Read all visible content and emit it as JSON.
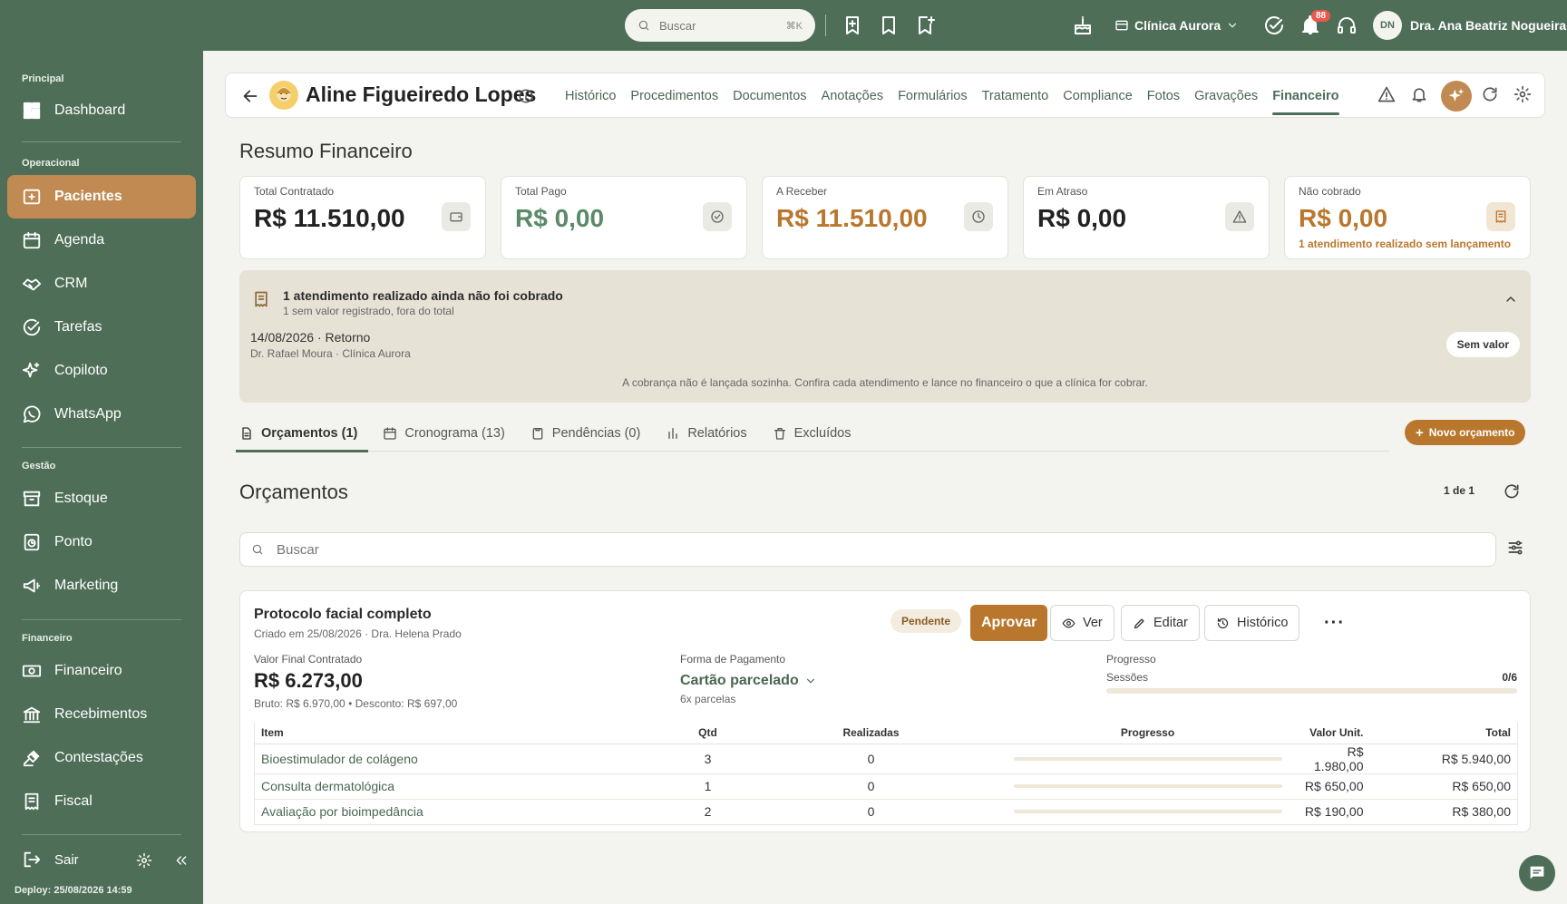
{
  "topbar": {
    "search_placeholder": "Buscar",
    "search_shortcut": "⌘K",
    "clinic": "Clínica Aurora",
    "notifications": "88",
    "user_initials": "DN",
    "user_name": "Dra. Ana Beatriz Nogueira"
  },
  "sidebar": {
    "sections": {
      "principal": "Principal",
      "operacional": "Operacional",
      "gestao": "Gestão",
      "financeiro": "Financeiro"
    },
    "items": {
      "dashboard": "Dashboard",
      "pacientes": "Pacientes",
      "agenda": "Agenda",
      "crm": "CRM",
      "tarefas": "Tarefas",
      "copiloto": "Copiloto",
      "whatsapp": "WhatsApp",
      "estoque": "Estoque",
      "ponto": "Ponto",
      "marketing": "Marketing",
      "financeiro": "Financeiro",
      "recebimentos": "Recebimentos",
      "contestacoes": "Contestações",
      "fiscal": "Fiscal"
    },
    "logout": "Sair",
    "deploy": "Deploy: 25/08/2026 14:59"
  },
  "patient": {
    "name": "Aline Figueiredo Lopes",
    "tabs": [
      "Histórico",
      "Procedimentos",
      "Documentos",
      "Anotações",
      "Formulários",
      "Tratamento",
      "Compliance",
      "Fotos",
      "Gravações",
      "Financeiro"
    ]
  },
  "summary": {
    "title": "Resumo Financeiro",
    "cards": [
      {
        "label": "Total Contratado",
        "value": "R$ 11.510,00",
        "color": "#222222"
      },
      {
        "label": "Total Pago",
        "value": "R$ 0,00",
        "color": "#5a8a68"
      },
      {
        "label": "A Receber",
        "value": "R$ 11.510,00",
        "color": "#b9772d"
      },
      {
        "label": "Em Atraso",
        "value": "R$ 0,00",
        "color": "#222222"
      },
      {
        "label": "Não cobrado",
        "value": "R$ 0,00",
        "color": "#b9772d",
        "note": "1 atendimento realizado sem lançamento"
      }
    ]
  },
  "alert": {
    "title": "1 atendimento realizado ainda não foi cobrado",
    "subtitle": "1 sem valor registrado, fora do total",
    "date_line": "14/08/2026 · Retorno",
    "doctor_line": "Dr. Rafael Moura · Clínica Aurora",
    "badge": "Sem valor",
    "footer": "A cobrança não é lançada sozinha. Confira cada atendimento e lance no financeiro o que a clínica for cobrar."
  },
  "subtabs": [
    "Orçamentos (1)",
    "Cronograma (13)",
    "Pendências (0)",
    "Relatórios",
    "Excluídos"
  ],
  "new_budget": "Novo orçamento",
  "budgets": {
    "title": "Orçamentos",
    "pagination": "1 de 1",
    "search_placeholder": "Buscar"
  },
  "budget": {
    "title": "Protocolo facial completo",
    "created": "Criado em 25/08/2026 · Dra. Helena Prado",
    "status": "Pendente",
    "approve": "Aprovar",
    "view": "Ver",
    "edit": "Editar",
    "history": "Histórico",
    "final_label": "Valor Final Contratado",
    "final_value": "R$ 6.273,00",
    "breakdown": "Bruto: R$ 6.970,00 • Desconto: R$ 697,00",
    "payment_label": "Forma de Pagamento",
    "payment_value": "Cartão parcelado",
    "installments": "6x parcelas",
    "progress_label": "Progresso",
    "sessions_label": "Sessões",
    "sessions_value": "0/6",
    "sessions_fraction": 0,
    "table": {
      "headers": [
        "Item",
        "Qtd",
        "Realizadas",
        "Progresso",
        "Valor Unit.",
        "Total"
      ],
      "rows": [
        {
          "item": "Bioestimulador de colágeno",
          "qtd": "3",
          "realizadas": "0",
          "progress": 0,
          "unit": "R$ 1.980,00",
          "total": "R$ 5.940,00"
        },
        {
          "item": "Consulta dermatológica",
          "qtd": "1",
          "realizadas": "0",
          "progress": 0,
          "unit": "R$ 650,00",
          "total": "R$ 650,00"
        },
        {
          "item": "Avaliação por bioimpedância",
          "qtd": "2",
          "realizadas": "0",
          "progress": 0,
          "unit": "R$ 190,00",
          "total": "R$ 380,00"
        }
      ]
    }
  }
}
